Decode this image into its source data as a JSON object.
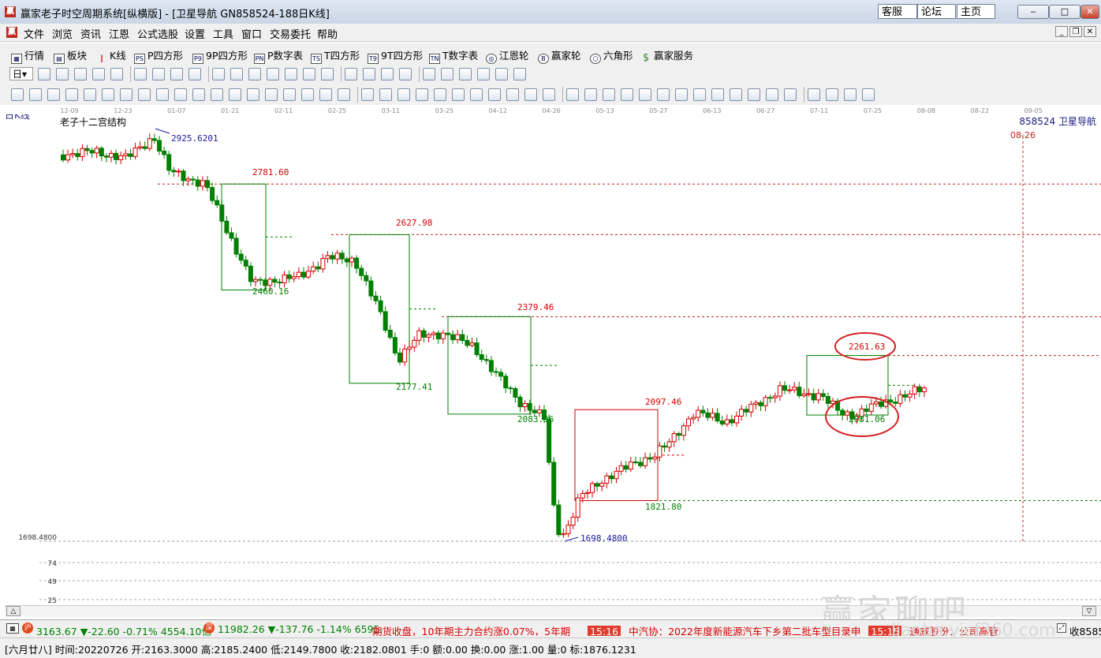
{
  "window": {
    "title": "赢家老子时空周期系统[纵横版] - [卫星导航  GN858524-188日K线]",
    "links": [
      "客服",
      "论坛",
      "主页"
    ],
    "controls": [
      "‒",
      "□",
      "✕"
    ]
  },
  "menu": [
    "文件",
    "浏览",
    "资讯",
    "江恩",
    "公式选股",
    "设置",
    "工具",
    "窗口",
    "交易委托",
    "帮助"
  ],
  "funcbar": [
    {
      "icon": "table-icon",
      "label": "行情"
    },
    {
      "icon": "blocks-icon",
      "label": "板块"
    },
    {
      "icon": "candle-icon",
      "label": "K线"
    },
    {
      "icon": "ps-icon",
      "label": "P四方形"
    },
    {
      "icon": "p9-icon",
      "label": "9P四方形"
    },
    {
      "icon": "pn-icon",
      "label": "P数字表"
    },
    {
      "icon": "ts-icon",
      "label": "T四方形"
    },
    {
      "icon": "t9-icon",
      "label": "9T四方形"
    },
    {
      "icon": "tn-icon",
      "label": "T数字表"
    },
    {
      "icon": "wheel-icon",
      "label": "江恩轮"
    },
    {
      "icon": "big-icon",
      "label": "赢家轮"
    },
    {
      "icon": "hexagon-icon",
      "label": "六角形"
    },
    {
      "icon": "dollar-icon",
      "label": "赢家服务"
    }
  ],
  "toolbar_period": "日",
  "chart": {
    "period_label": "日K线",
    "indicator_title": "老子十二宫结构",
    "symbol_label": "858524 卫星导航",
    "date_ticks": [
      "12-09",
      "12-23",
      "01-07",
      "01-21",
      "02-11",
      "02-25",
      "03-11",
      "03-25",
      "04-12",
      "04-26",
      "05-13",
      "05-27",
      "06-13",
      "06-27",
      "07-11",
      "07-25",
      "08-08",
      "08-22",
      "09-05"
    ],
    "future_marker": "08-26",
    "axis_low": "1698.4800",
    "volume_ticks": [
      "74",
      "49",
      "25"
    ],
    "price_labels": [
      {
        "text": "2925.6201",
        "color": "#1a1aa0"
      },
      {
        "text": "2781.60",
        "color": "#d40000"
      },
      {
        "text": "2460.16",
        "color": "#008000"
      },
      {
        "text": "2627.98",
        "color": "#d40000"
      },
      {
        "text": "2177.41",
        "color": "#008000"
      },
      {
        "text": "2379.46",
        "color": "#d40000"
      },
      {
        "text": "2083.96",
        "color": "#008000"
      },
      {
        "text": "2097.46",
        "color": "#d40000"
      },
      {
        "text": "1821.80",
        "color": "#008000"
      },
      {
        "text": "1698.4800",
        "color": "#1a1aa0"
      },
      {
        "text": "2261.63",
        "color": "#d40000"
      },
      {
        "text": "2081.06",
        "color": "#008000"
      }
    ]
  },
  "ticker": {
    "idx1": {
      "price": "3163.67",
      "change": "▼-22.60",
      "pct": "-0.71%",
      "amount": "4554.10亿"
    },
    "idx2": {
      "price": "11982.26",
      "change": "▼-137.76",
      "pct": "-1.14%",
      "amount": "6595."
    },
    "news1": "期货收盘，10年期主力合约涨0.07%，5年期",
    "news2_time": "15:16",
    "news2": "中汽协：2022年度新能源汽车下乡第二批车型目录申",
    "news3_time": "15:15",
    "news3": "通威股份：公司高管",
    "tail": "收8585"
  },
  "status": "[六月廿八] 时间:20220726 开:2163.3000 高:2185.2400 低:2149.7800 收:2182.0801 手:0 额:0.00 换:0.00 涨:1.00 量:0 标:1876.1231",
  "watermark": {
    "main": "赢家聊吧",
    "url": "liaoba.yjcf360.com"
  },
  "colors": {
    "up": "#d40000",
    "down": "#008000",
    "accent": "#c0281e",
    "grid": "#b0b0b0"
  }
}
